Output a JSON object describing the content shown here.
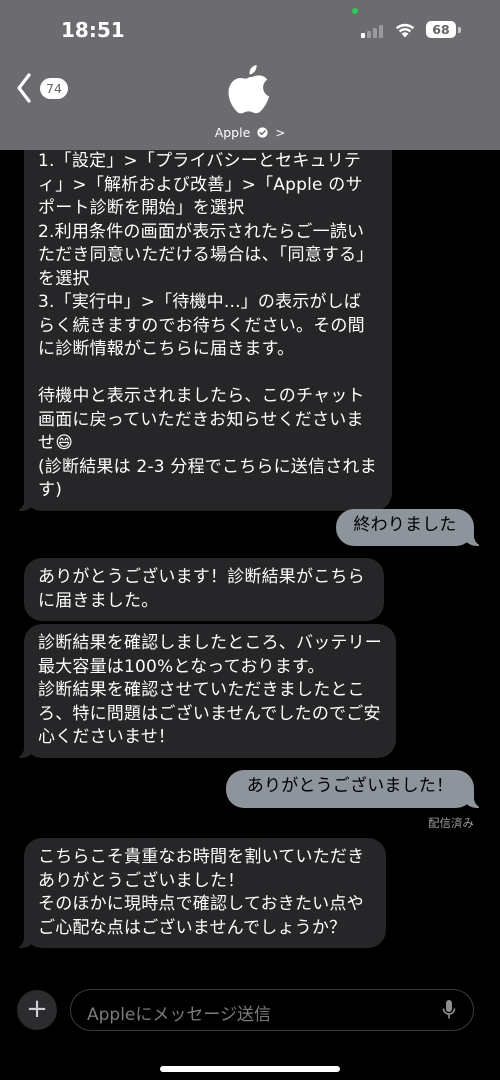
{
  "status_bar": {
    "time": "18:51",
    "battery": "68"
  },
  "header": {
    "back_count": "74",
    "contact_name": "Apple",
    "contact_chevron": ">",
    "logo_icon": "apple-logo-icon",
    "verified_icon": "verified-badge-icon"
  },
  "messages": [
    {
      "direction": "incoming",
      "text": "1.「設定」>「プライバシーとセキュリティ」>「解析および改善」>「Apple のサポート診断を開始」を選択\n2.利用条件の画面が表示されたらご一読いただき同意いただける場合は、「同意する」を選択\n3.「実行中」>「待機中...」の表示がしばらく続きますのでお待ちください。その間に診断情報がこちらに届きます。\n\n待機中と表示されましたら、このチャット画面に戻っていただきお知らせくださいませ😄\n(診断結果は 2-3 分程でこちらに送信されます)"
    },
    {
      "direction": "outgoing",
      "text": "終わりました"
    },
    {
      "direction": "incoming",
      "text": "ありがとうございます！診断結果がこちらに届きました。"
    },
    {
      "direction": "incoming",
      "text": "診断結果を確認しましたところ、バッテリー最大容量は100%となっております。\n診断結果を確認させていただきましたところ、特に問題はございませんでしたのでご安心くださいませ！"
    },
    {
      "direction": "outgoing",
      "text": "ありがとうございました！"
    },
    {
      "direction": "incoming",
      "text": "こちらこそ貴重なお時間を割いていただきありがとうございました！\nそのほかに現時点で確認しておきたい点やご心配な点はございませんでしょうか？"
    }
  ],
  "delivered_label": "配信済み",
  "input": {
    "plus_label": "+",
    "placeholder": "Appleにメッセージ送信"
  },
  "colors": {
    "incoming_bubble": "#262628",
    "outgoing_bubble": "#8e949c",
    "header_bg": "#6e6e72",
    "background": "#000000"
  }
}
